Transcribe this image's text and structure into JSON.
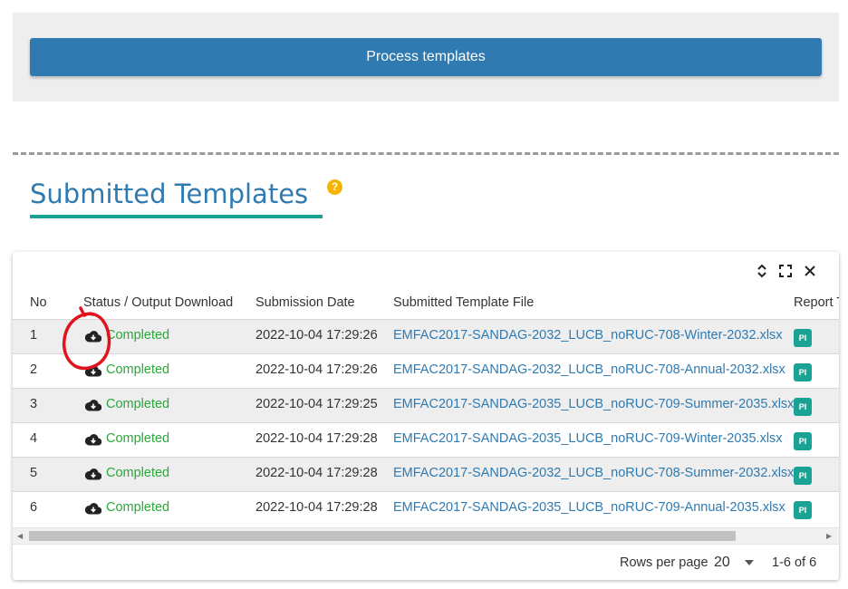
{
  "process": {
    "button_label": "Process templates"
  },
  "section": {
    "title": "Submitted Templates",
    "help_icon": "?"
  },
  "table": {
    "toolbar_icons": [
      "expand-collapse-icon",
      "fullscreen-icon",
      "close-icon"
    ],
    "columns": {
      "no": "No",
      "status": "Status / Output Download",
      "date": "Submission Date",
      "file": "Submitted Template File",
      "report": "Report T"
    },
    "rows": [
      {
        "no": "1",
        "status": "Completed",
        "date": "2022-10-04 17:29:26",
        "file": "EMFAC2017-SANDAG-2032_LUCB_noRUC-708-Winter-2032.xlsx",
        "report_badge": "PI"
      },
      {
        "no": "2",
        "status": "Completed",
        "date": "2022-10-04 17:29:26",
        "file": "EMFAC2017-SANDAG-2032_LUCB_noRUC-708-Annual-2032.xlsx",
        "report_badge": "PI"
      },
      {
        "no": "3",
        "status": "Completed",
        "date": "2022-10-04 17:29:25",
        "file": "EMFAC2017-SANDAG-2035_LUCB_noRUC-709-Summer-2035.xlsx",
        "report_badge": "PI"
      },
      {
        "no": "4",
        "status": "Completed",
        "date": "2022-10-04 17:29:28",
        "file": "EMFAC2017-SANDAG-2035_LUCB_noRUC-709-Winter-2035.xlsx",
        "report_badge": "PI"
      },
      {
        "no": "5",
        "status": "Completed",
        "date": "2022-10-04 17:29:28",
        "file": "EMFAC2017-SANDAG-2032_LUCB_noRUC-708-Summer-2032.xlsx",
        "report_badge": "PI"
      },
      {
        "no": "6",
        "status": "Completed",
        "date": "2022-10-04 17:29:28",
        "file": "EMFAC2017-SANDAG-2035_LUCB_noRUC-709-Annual-2035.xlsx",
        "report_badge": "PI"
      }
    ],
    "download_icon": "cloud-download-icon"
  },
  "pagination": {
    "rows_per_page_label": "Rows per page",
    "rows_per_page_value": "20",
    "range_text": "1-6 of 6"
  },
  "colors": {
    "primary": "#2f7ab0",
    "accent": "#1aa394",
    "status_completed": "#2aa83a",
    "help": "#f4b400",
    "annotation": "#e0141e"
  }
}
